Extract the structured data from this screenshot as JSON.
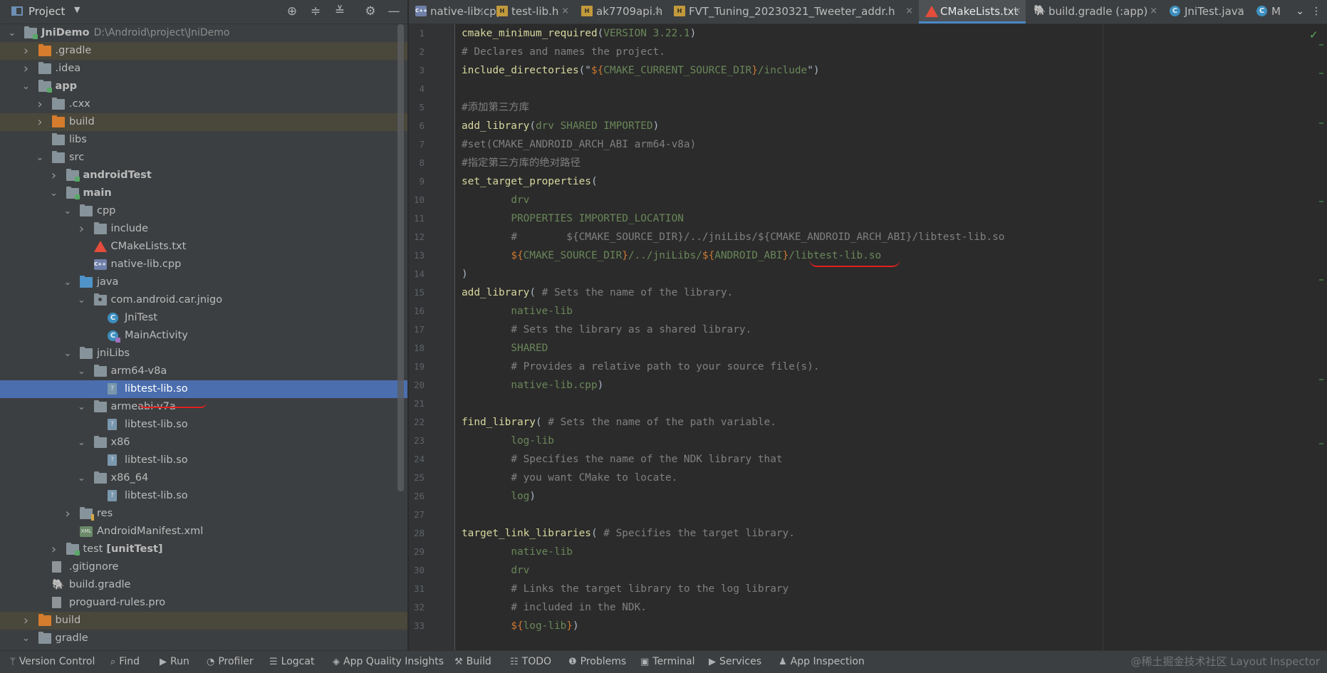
{
  "project_panel": {
    "title": "Project",
    "dropdown": "▼",
    "tools": [
      "⊕",
      "≑",
      "≚",
      "⚙",
      "—"
    ],
    "tree": [
      {
        "label": "JniDemo",
        "path": "D:\\Android\\project\\JniDemo",
        "icon": "module-folder-icon",
        "arrow": "down",
        "indent": 0,
        "bold": true
      },
      {
        "label": ".gradle",
        "icon": "orange-folder-icon",
        "arrow": "right",
        "indent": 1,
        "hl": true
      },
      {
        "label": ".idea",
        "icon": "folder-icon",
        "arrow": "right",
        "indent": 1
      },
      {
        "label": "app",
        "icon": "module-folder-icon",
        "arrow": "down",
        "indent": 1,
        "bold": true
      },
      {
        "label": ".cxx",
        "icon": "folder-icon",
        "arrow": "right",
        "indent": 2
      },
      {
        "label": "build",
        "icon": "orange-folder-icon",
        "arrow": "right",
        "indent": 2,
        "hl": true
      },
      {
        "label": "libs",
        "icon": "folder-icon",
        "arrow": "",
        "indent": 2
      },
      {
        "label": "src",
        "icon": "folder-icon",
        "arrow": "down",
        "indent": 2
      },
      {
        "label": "androidTest",
        "icon": "module-folder-icon",
        "arrow": "right",
        "indent": 3,
        "bold": true
      },
      {
        "label": "main",
        "icon": "module-folder-icon",
        "arrow": "down",
        "indent": 3,
        "bold": true
      },
      {
        "label": "cpp",
        "icon": "folder-icon",
        "arrow": "down",
        "indent": 4
      },
      {
        "label": "include",
        "icon": "folder-icon",
        "arrow": "right",
        "indent": 5
      },
      {
        "label": "CMakeLists.txt",
        "icon": "cmake-icon",
        "arrow": "",
        "indent": 5
      },
      {
        "label": "native-lib.cpp",
        "icon": "cpp-file-icon",
        "arrow": "",
        "indent": 5
      },
      {
        "label": "java",
        "icon": "blue-folder-icon",
        "arrow": "down",
        "indent": 4
      },
      {
        "label": "com.android.car.jnigo",
        "icon": "package-icon",
        "arrow": "down",
        "indent": 5
      },
      {
        "label": "JniTest",
        "icon": "class-icon",
        "arrow": "",
        "indent": 6
      },
      {
        "label": "MainActivity",
        "icon": "activity-class-icon",
        "arrow": "",
        "indent": 6
      },
      {
        "label": "jniLibs",
        "icon": "folder-icon",
        "arrow": "down",
        "indent": 4
      },
      {
        "label": "arm64-v8a",
        "icon": "folder-icon",
        "arrow": "down",
        "indent": 5
      },
      {
        "label": "libtest-lib.so",
        "icon": "so-file-icon",
        "arrow": "",
        "indent": 6,
        "sel": true
      },
      {
        "label": "armeabi-v7a",
        "icon": "folder-icon",
        "arrow": "down",
        "indent": 5
      },
      {
        "label": "libtest-lib.so",
        "icon": "so-file-icon",
        "arrow": "",
        "indent": 6
      },
      {
        "label": "x86",
        "icon": "folder-icon",
        "arrow": "down",
        "indent": 5
      },
      {
        "label": "libtest-lib.so",
        "icon": "so-file-icon",
        "arrow": "",
        "indent": 6
      },
      {
        "label": "x86_64",
        "icon": "folder-icon",
        "arrow": "down",
        "indent": 5
      },
      {
        "label": "libtest-lib.so",
        "icon": "so-file-icon",
        "arrow": "",
        "indent": 6
      },
      {
        "label": "res",
        "icon": "res-folder-icon",
        "arrow": "right",
        "indent": 4
      },
      {
        "label": "AndroidManifest.xml",
        "icon": "xml-file-icon",
        "arrow": "",
        "indent": 4
      },
      {
        "label": "test",
        "extra": "[unitTest]",
        "icon": "module-folder-icon",
        "arrow": "right",
        "indent": 3
      },
      {
        "label": ".gitignore",
        "icon": "file-icon",
        "arrow": "",
        "indent": 2
      },
      {
        "label": "build.gradle",
        "icon": "gradle-icon",
        "arrow": "",
        "indent": 2
      },
      {
        "label": "proguard-rules.pro",
        "icon": "file-icon",
        "arrow": "",
        "indent": 2
      },
      {
        "label": "build",
        "icon": "orange-folder-icon",
        "arrow": "right",
        "indent": 1,
        "hl": true
      },
      {
        "label": "gradle",
        "icon": "folder-icon",
        "arrow": "down",
        "indent": 1
      }
    ]
  },
  "tabs": [
    {
      "label": "native-lib.cpp",
      "icon": "cpp-file-icon"
    },
    {
      "label": "test-lib.h",
      "icon": "header-file-icon"
    },
    {
      "label": "ak7709api.h",
      "icon": "header-file-icon"
    },
    {
      "label": "FVT_Tuning_20230321_Tweeter_addr.h",
      "icon": "header-file-icon"
    },
    {
      "label": "CMakeLists.txt",
      "icon": "cmake-icon",
      "active": true
    },
    {
      "label": "build.gradle (:app)",
      "icon": "gradle-icon"
    },
    {
      "label": "JniTest.java",
      "icon": "class-icon"
    },
    {
      "label": "M",
      "icon": "activity-class-icon"
    }
  ],
  "tab_close_glyph": "×",
  "tabs_overflow": "⋮",
  "tabs_menu": "⌄",
  "check_glyph": "✓",
  "code_lines": [
    [
      [
        "fn",
        "cmake_minimum_required"
      ],
      [
        "t",
        "("
      ],
      [
        "kw",
        "VERSION 3.22.1"
      ],
      [
        "t",
        ")"
      ]
    ],
    [
      [
        "cm",
        "# Declares and names the project."
      ]
    ],
    [
      [
        "fn",
        "include_directories"
      ],
      [
        "t",
        "(\""
      ],
      [
        "var",
        "${"
      ],
      [
        "kw",
        "CMAKE_CURRENT_SOURCE_DIR"
      ],
      [
        "var",
        "}"
      ],
      [
        "kw",
        "/include"
      ],
      [
        "t",
        "\")"
      ]
    ],
    [],
    [
      [
        "cm",
        "#添加第三方库"
      ]
    ],
    [
      [
        "fn",
        "add_library"
      ],
      [
        "t",
        "("
      ],
      [
        "kw",
        "drv SHARED IMPORTED"
      ],
      [
        "t",
        ")"
      ]
    ],
    [
      [
        "cm",
        "#set(CMAKE_ANDROID_ARCH_ABI arm64-v8a)"
      ]
    ],
    [
      [
        "cm",
        "#指定第三方库的绝对路径"
      ]
    ],
    [
      [
        "fn",
        "set_target_properties"
      ],
      [
        "t",
        "("
      ]
    ],
    [
      [
        "t",
        "        "
      ],
      [
        "kw",
        "drv"
      ]
    ],
    [
      [
        "t",
        "        "
      ],
      [
        "kw",
        "PROPERTIES IMPORTED_LOCATION"
      ]
    ],
    [
      [
        "t",
        "        "
      ],
      [
        "cm",
        "#        ${CMAKE_SOURCE_DIR}/../jniLibs/${CMAKE_ANDROID_ARCH_ABI}/libtest-lib.so"
      ]
    ],
    [
      [
        "t",
        "        "
      ],
      [
        "var",
        "${"
      ],
      [
        "kw",
        "CMAKE_SOURCE_DIR"
      ],
      [
        "var",
        "}"
      ],
      [
        "kw",
        "/../jniLibs/"
      ],
      [
        "var",
        "${"
      ],
      [
        "kw",
        "ANDROID_ABI"
      ],
      [
        "var",
        "}"
      ],
      [
        "kw",
        "/libtest-lib.so"
      ]
    ],
    [
      [
        "t",
        ")"
      ]
    ],
    [
      [
        "fn",
        "add_library"
      ],
      [
        "t",
        "( "
      ],
      [
        "cm",
        "# Sets the name of the library."
      ]
    ],
    [
      [
        "t",
        "        "
      ],
      [
        "kw",
        "native-lib"
      ]
    ],
    [
      [
        "t",
        "        "
      ],
      [
        "cm",
        "# Sets the library as a shared library."
      ]
    ],
    [
      [
        "t",
        "        "
      ],
      [
        "kw",
        "SHARED"
      ]
    ],
    [
      [
        "t",
        "        "
      ],
      [
        "cm",
        "# Provides a relative path to your source file(s)."
      ]
    ],
    [
      [
        "t",
        "        "
      ],
      [
        "kw",
        "native-lib.cpp"
      ],
      [
        "t",
        ")"
      ]
    ],
    [],
    [
      [
        "fn",
        "find_library"
      ],
      [
        "t",
        "( "
      ],
      [
        "cm",
        "# Sets the name of the path variable."
      ]
    ],
    [
      [
        "t",
        "        "
      ],
      [
        "kw",
        "log-lib"
      ]
    ],
    [
      [
        "t",
        "        "
      ],
      [
        "cm",
        "# Specifies the name of the NDK library that"
      ]
    ],
    [
      [
        "t",
        "        "
      ],
      [
        "cm",
        "# you want CMake to locate."
      ]
    ],
    [
      [
        "t",
        "        "
      ],
      [
        "kw",
        "log"
      ],
      [
        "t",
        ")"
      ]
    ],
    [],
    [
      [
        "fn",
        "target_link_libraries"
      ],
      [
        "t",
        "( "
      ],
      [
        "cm",
        "# Specifies the target library."
      ]
    ],
    [
      [
        "t",
        "        "
      ],
      [
        "kw",
        "native-lib"
      ]
    ],
    [
      [
        "t",
        "        "
      ],
      [
        "kw",
        "drv"
      ]
    ],
    [
      [
        "t",
        "        "
      ],
      [
        "cm",
        "# Links the target library to the log library"
      ]
    ],
    [
      [
        "t",
        "        "
      ],
      [
        "cm",
        "# included in the NDK."
      ]
    ],
    [
      [
        "t",
        "        "
      ],
      [
        "var",
        "${"
      ],
      [
        "kw",
        "log-lib"
      ],
      [
        "var",
        "}"
      ],
      [
        "t",
        ")"
      ]
    ]
  ],
  "status_bar": [
    {
      "label": "Version Control",
      "icon": "version-control-icon",
      "glyph": "ᛘ"
    },
    {
      "label": "Find",
      "icon": "search-icon",
      "glyph": "⌕"
    },
    {
      "label": "Run",
      "icon": "run-icon",
      "glyph": "▶"
    },
    {
      "label": "Profiler",
      "icon": "profiler-icon",
      "glyph": "◔"
    },
    {
      "label": "Logcat",
      "icon": "logcat-icon",
      "glyph": "☰"
    },
    {
      "label": "App Quality Insights",
      "icon": "app-quality-icon",
      "glyph": "◈"
    },
    {
      "label": "Build",
      "icon": "build-hammer-icon",
      "glyph": "⚒"
    },
    {
      "label": "TODO",
      "icon": "todo-icon",
      "glyph": "☷"
    },
    {
      "label": "Problems",
      "icon": "problems-icon",
      "glyph": "❶"
    },
    {
      "label": "Terminal",
      "icon": "terminal-icon",
      "glyph": "▣"
    },
    {
      "label": "Services",
      "icon": "services-icon",
      "glyph": "▶"
    },
    {
      "label": "App Inspection",
      "icon": "app-inspection-icon",
      "glyph": "♟"
    }
  ],
  "watermark": "@稀土掘金技术社区 Layout Inspector",
  "colors": {
    "accent": "#4a88c7",
    "selection": "#4b6eaf",
    "keyword": "#6a8759",
    "variable": "#cc7832",
    "function": "#d8d8a0",
    "comment": "#808080"
  }
}
